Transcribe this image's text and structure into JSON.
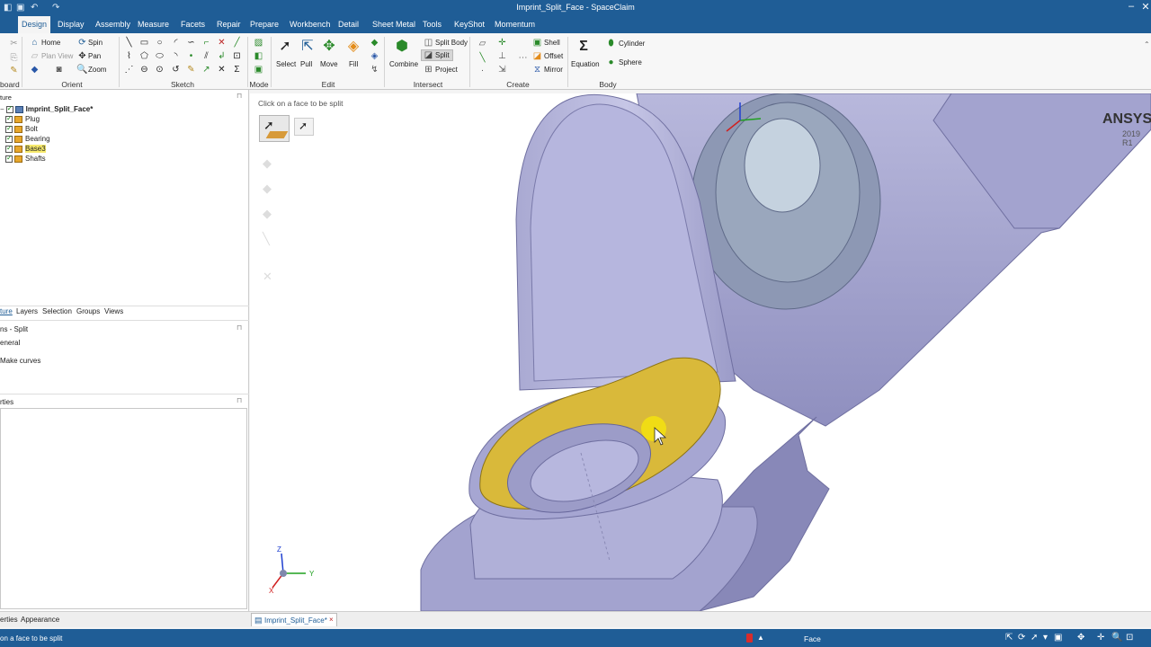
{
  "app": {
    "title": "Imprint_Split_Face - SpaceClaim"
  },
  "menu": [
    "Design",
    "Display",
    "Assembly",
    "Measure",
    "Facets",
    "Repair",
    "Prepare",
    "Workbench",
    "Detail",
    "Sheet Metal",
    "Tools",
    "KeyShot",
    "Momentum"
  ],
  "ribbon": {
    "orient": {
      "home": "Home",
      "spin": "Spin",
      "plan_view": "Plan View",
      "pan": "Pan",
      "zoom": "Zoom"
    },
    "edit": {
      "select": "Select",
      "pull": "Pull",
      "move": "Move",
      "fill": "Fill"
    },
    "intersect": {
      "combine": "Combine",
      "split_body": "Split Body",
      "split": "Split",
      "project": "Project"
    },
    "create": {
      "shell": "Shell",
      "offset": "Offset",
      "mirror": "Mirror"
    },
    "body": {
      "equation": "Equation",
      "cylinder": "Cylinder",
      "sphere": "Sphere"
    },
    "groups": {
      "clipboard": "board",
      "orient": "Orient",
      "sketch": "Sketch",
      "mode": "Mode",
      "edit": "Edit",
      "intersect": "Intersect",
      "create": "Create",
      "body": "Body"
    }
  },
  "structure_tree": {
    "heading": "ture",
    "root": "Imprint_Split_Face*",
    "items": [
      "Plug",
      "Bolt",
      "Bearing",
      "Base3",
      "Shafts"
    ]
  },
  "panel_tabs": [
    "ture",
    "Layers",
    "Selection",
    "Groups",
    "Views"
  ],
  "options": {
    "heading": "ns - Split",
    "general": "eneral",
    "make_curves": "Make curves"
  },
  "properties_heading": "rties",
  "viewport": {
    "hint": "Click on a face to be split",
    "brand": "ANSYS",
    "version": "2019 R1"
  },
  "triad": {
    "x": "X",
    "y": "Y",
    "z": "Z"
  },
  "bottom_tabs": {
    "left_a": "erties",
    "left_b": "Appearance",
    "doc_tab": "Imprint_Split_Face*",
    "close": "×"
  },
  "status": {
    "message": "on a face to be split",
    "selection_filter": "Face"
  },
  "colors": {
    "titlebar": "#1f5d96",
    "part": "#b8b8d9",
    "selected_face": "#d9b93a"
  }
}
